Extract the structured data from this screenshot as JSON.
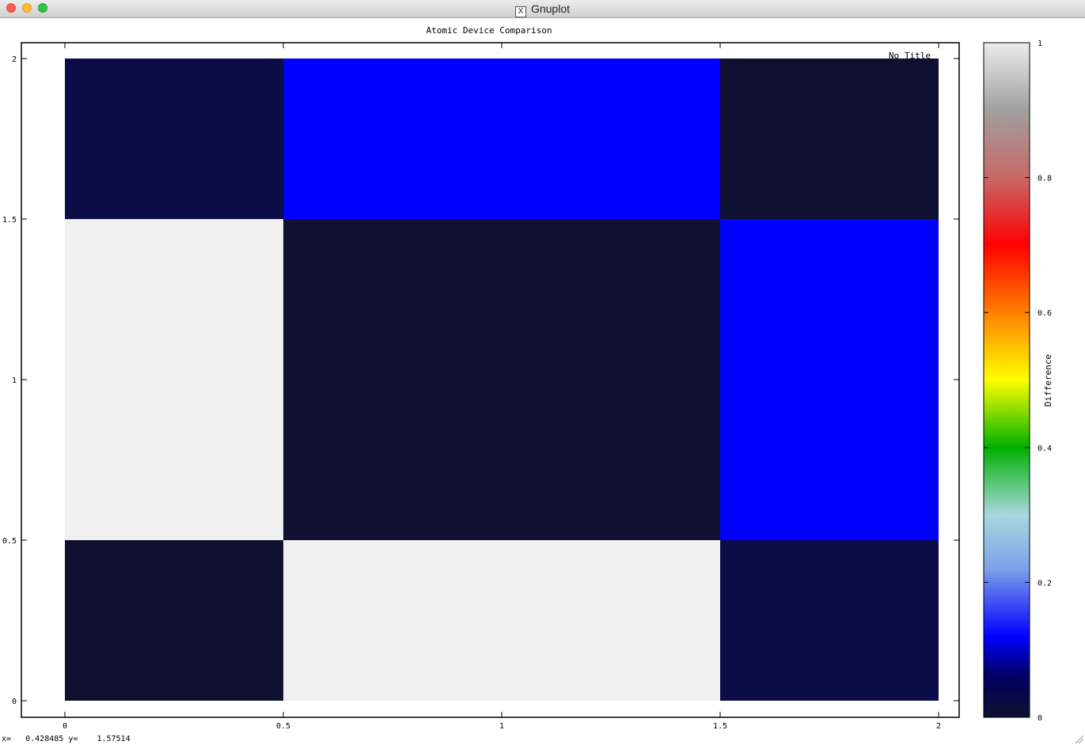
{
  "window": {
    "title": "Gnuplot"
  },
  "status": {
    "x_label": "x=",
    "x_value": "0.428485",
    "y_label": "y=",
    "y_value": "1.57514"
  },
  "chart_data": {
    "type": "heatmap",
    "title": "Atomic Device Comparison",
    "key_title": "No Title",
    "xlabel": "",
    "ylabel": "",
    "xlim": [
      0,
      2
    ],
    "ylim": [
      0,
      2
    ],
    "x_ticks": [
      0,
      0.5,
      1,
      1.5,
      2
    ],
    "x_tick_labels": [
      "0",
      "0.5",
      "1",
      "1.5",
      "2"
    ],
    "y_ticks": [
      0,
      0.5,
      1,
      1.5,
      2
    ],
    "y_tick_labels": [
      "0",
      "0.5",
      "1",
      "1.5",
      "2"
    ],
    "x_centers": [
      0,
      1,
      2
    ],
    "y_centers": [
      0,
      1,
      2
    ],
    "values": [
      [
        0.0,
        1.0,
        0.03
      ],
      [
        1.0,
        0.0,
        0.1
      ],
      [
        0.03,
        0.1,
        0.0
      ]
    ],
    "colorbar": {
      "label": "Difference",
      "range": [
        0,
        1
      ],
      "ticks": [
        0,
        0.2,
        0.4,
        0.6,
        0.8,
        1
      ],
      "tick_labels": [
        "0",
        "0.2",
        "0.4",
        "0.6",
        "0.8",
        "1"
      ]
    },
    "grid": false
  }
}
